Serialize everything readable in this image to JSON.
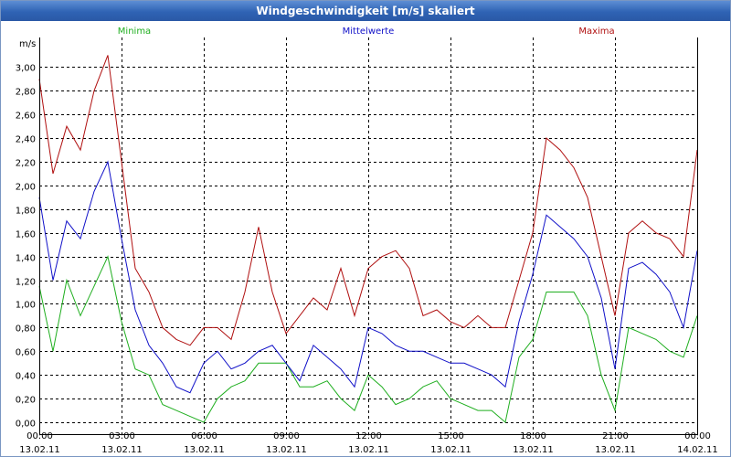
{
  "window": {
    "title": "Windgeschwindigkeit [m/s] skaliert"
  },
  "chart_data": {
    "type": "line",
    "title": "Windgeschwindigkeit [m/s] skaliert",
    "ylabel": "m/s",
    "xlabel": "",
    "ylim": [
      -0.1,
      3.25
    ],
    "xlim": [
      0,
      24
    ],
    "yticks": [
      0,
      0.2,
      0.4,
      0.6,
      0.8,
      1.0,
      1.2,
      1.4,
      1.6,
      1.8,
      2.0,
      2.2,
      2.4,
      2.6,
      2.8,
      3.0
    ],
    "ytick_labels": [
      "0,00",
      "0,20",
      "0,40",
      "0,60",
      "0,80",
      "1,00",
      "1,20",
      "1,40",
      "1,60",
      "1,80",
      "2,00",
      "2,20",
      "2,40",
      "2,60",
      "2,80",
      "3,00"
    ],
    "xtick_times": [
      "00:00",
      "03:00",
      "06:00",
      "09:00",
      "12:00",
      "15:00",
      "18:00",
      "21:00",
      "00:00"
    ],
    "xtick_dates": [
      "13.02.11",
      "13.02.11",
      "13.02.11",
      "13.02.11",
      "13.02.11",
      "13.02.11",
      "13.02.11",
      "13.02.11",
      "14.02.11"
    ],
    "grid": true,
    "legend_position": "top",
    "x_hours": [
      0,
      0.5,
      1,
      1.5,
      2,
      2.5,
      3,
      3.5,
      4,
      4.5,
      5,
      5.5,
      6,
      6.5,
      7,
      7.5,
      8,
      8.5,
      9,
      9.5,
      10,
      10.5,
      11,
      11.5,
      12,
      12.5,
      13,
      13.5,
      14,
      14.5,
      15,
      15.5,
      16,
      16.5,
      17,
      17.5,
      18,
      18.5,
      19,
      19.5,
      20,
      20.5,
      21,
      21.5,
      22,
      22.5,
      23,
      23.5,
      24
    ],
    "series": [
      {
        "name": "Minima",
        "color": "#1fae1f",
        "values": [
          1.15,
          0.6,
          1.2,
          0.9,
          1.15,
          1.4,
          0.85,
          0.45,
          0.4,
          0.15,
          0.1,
          0.05,
          0,
          0.2,
          0.3,
          0.35,
          0.5,
          0.5,
          0.5,
          0.3,
          0.3,
          0.35,
          0.2,
          0.1,
          0.4,
          0.3,
          0.15,
          0.2,
          0.3,
          0.35,
          0.2,
          0.15,
          0.1,
          0.1,
          0,
          0.55,
          0.7,
          1.1,
          1.1,
          1.1,
          0.9,
          0.4,
          0.1,
          0.8,
          0.75,
          0.7,
          0.6,
          0.55,
          0.9
        ]
      },
      {
        "name": "Mittelwerte",
        "color": "#1010c8",
        "values": [
          1.9,
          1.2,
          1.7,
          1.55,
          1.95,
          2.2,
          1.55,
          0.95,
          0.65,
          0.5,
          0.3,
          0.25,
          0.5,
          0.6,
          0.45,
          0.5,
          0.6,
          0.65,
          0.5,
          0.35,
          0.65,
          0.55,
          0.45,
          0.3,
          0.8,
          0.75,
          0.65,
          0.6,
          0.6,
          0.55,
          0.5,
          0.5,
          0.45,
          0.4,
          0.3,
          0.85,
          1.25,
          1.75,
          1.65,
          1.55,
          1.4,
          1.05,
          0.45,
          1.3,
          1.35,
          1.25,
          1.1,
          0.8,
          1.45
        ]
      },
      {
        "name": "Maxima",
        "color": "#b01010",
        "values": [
          2.9,
          2.1,
          2.5,
          2.3,
          2.8,
          3.1,
          2.2,
          1.3,
          1.1,
          0.8,
          0.7,
          0.65,
          0.8,
          0.8,
          0.7,
          1.1,
          1.65,
          1.1,
          0.75,
          0.9,
          1.05,
          0.95,
          1.3,
          0.9,
          1.3,
          1.4,
          1.45,
          1.3,
          0.9,
          0.95,
          0.85,
          0.8,
          0.9,
          0.8,
          0.8,
          1.2,
          1.6,
          2.4,
          2.3,
          2.15,
          1.9,
          1.4,
          0.9,
          1.6,
          1.7,
          1.6,
          1.55,
          1.4,
          2.3
        ]
      }
    ]
  }
}
